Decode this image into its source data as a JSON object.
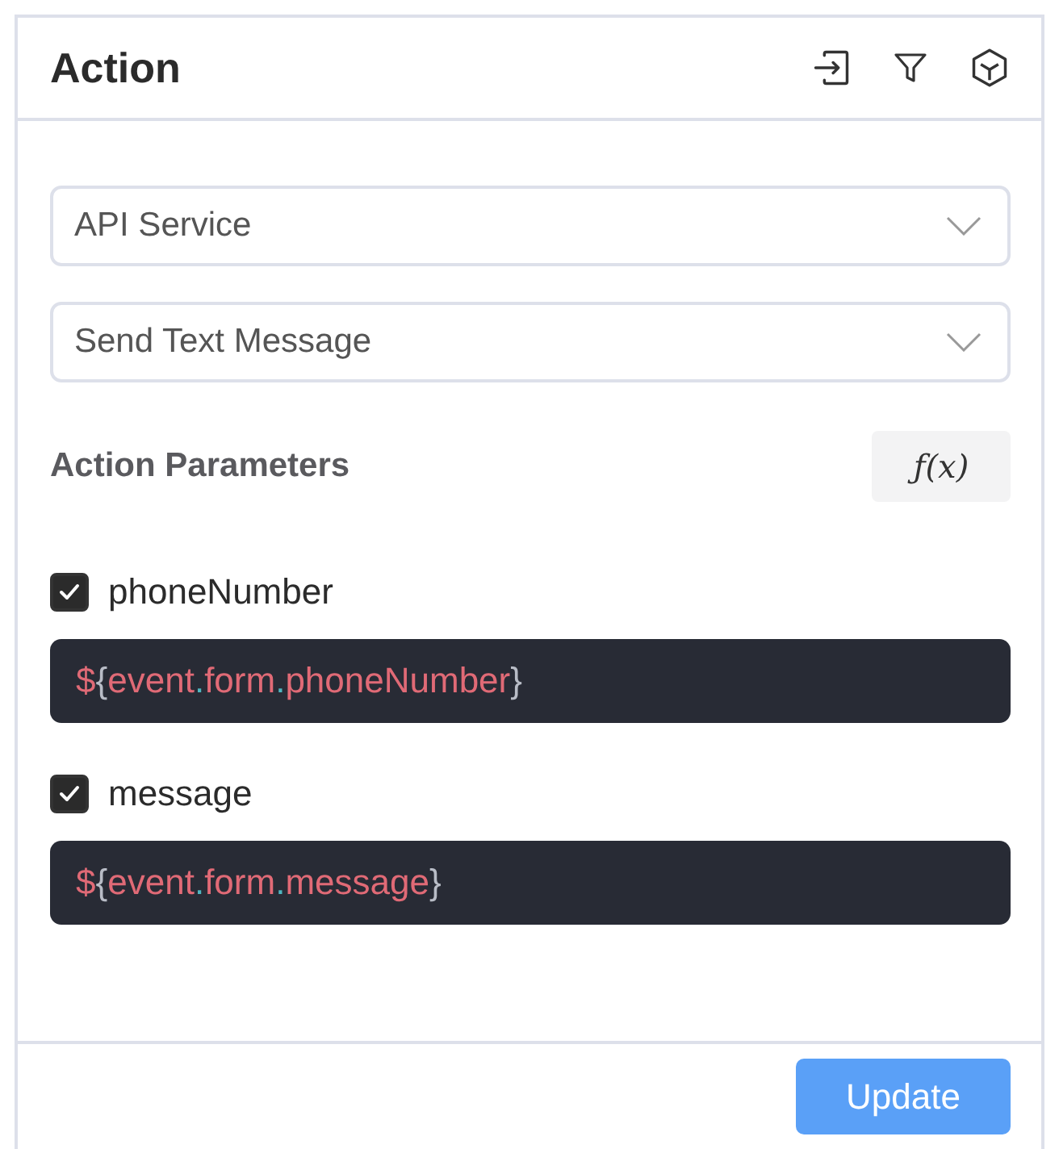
{
  "panel": {
    "title": "Action"
  },
  "dropdowns": [
    {
      "value": "API Service"
    },
    {
      "value": "Send Text Message"
    }
  ],
  "parameters": {
    "heading": "Action Parameters",
    "function_button": "ƒ(x)",
    "items": [
      {
        "name": "phoneNumber",
        "checked": true,
        "value": "${event.form.phoneNumber}"
      },
      {
        "name": "message",
        "checked": true,
        "value": "${event.form.message}"
      }
    ]
  },
  "footer": {
    "button": "Update"
  }
}
